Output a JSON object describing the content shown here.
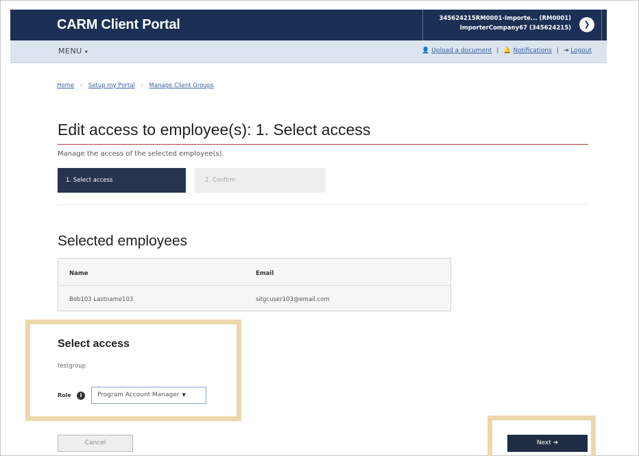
{
  "header": {
    "portal_title": "CARM Client Portal",
    "account_line1": "345624215RM0001-Importe... (RM0001)",
    "account_line2": "ImporterCompany67 (345624215)",
    "toggle_icon": "chevron-down-icon"
  },
  "menubar": {
    "menu_label": "MENU",
    "upload_label": "Upload a document",
    "notifications_label": "Notifications",
    "logout_label": "Logout"
  },
  "breadcrumb": {
    "items": [
      "Home",
      "Setup my Portal",
      "Manage Client Groups"
    ],
    "separator": "›"
  },
  "page": {
    "title": "Edit access to employee(s): 1. Select access",
    "subtitle": "Manage the access of the selected employee(s)."
  },
  "stepper": {
    "active": "1. Select access",
    "inactive": "2. Confirm"
  },
  "employees": {
    "title": "Selected employees",
    "columns": [
      "Name",
      "Email"
    ],
    "rows": [
      {
        "name": "Bob103 Lastname103",
        "email": "sitgcuser103@email.com"
      }
    ]
  },
  "access": {
    "title": "Select access",
    "group_name": "testgroup",
    "role_label": "Role",
    "role_value": "Program Account Manager"
  },
  "actions": {
    "cancel_label": "Cancel",
    "next_label": "Next ➔"
  },
  "colors": {
    "header_bg": "#1c2f55",
    "menubar_bg": "#dce4f0",
    "active_step": "#26344d",
    "highlight": "#edd8ad"
  }
}
